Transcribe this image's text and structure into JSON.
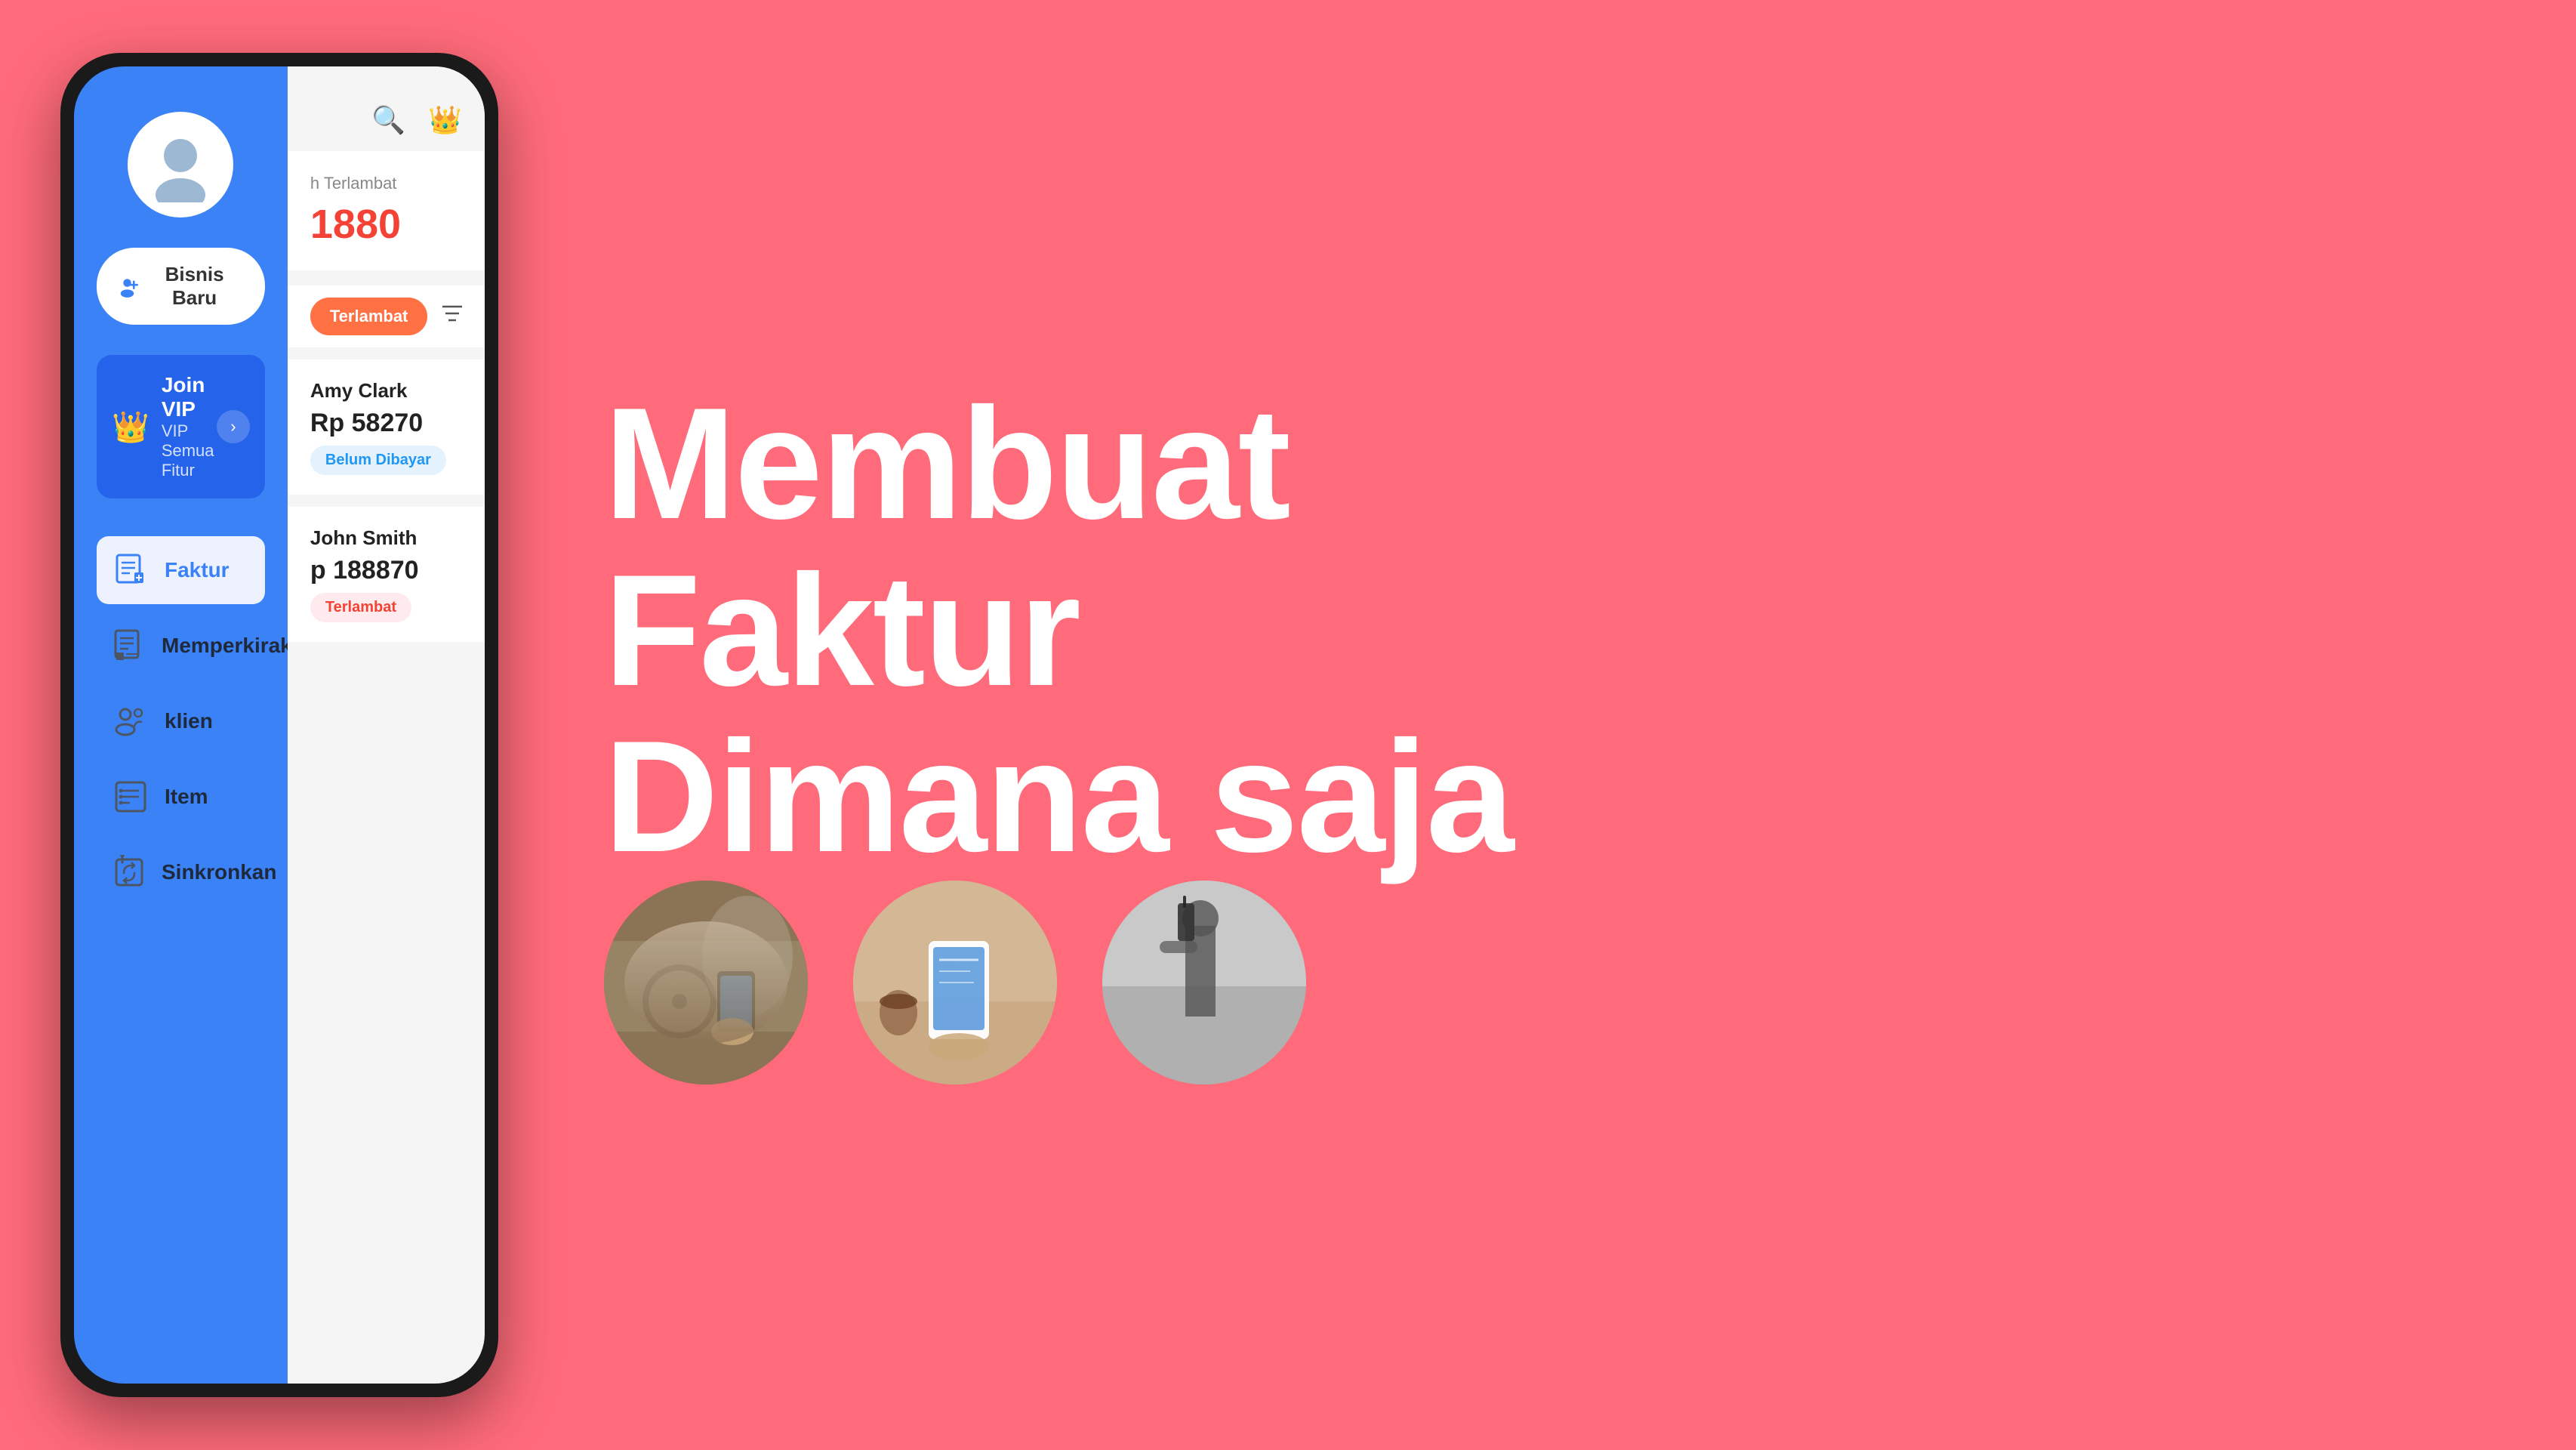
{
  "background_color": "#FF6B7A",
  "phone": {
    "sidebar": {
      "avatar_alt": "user avatar",
      "bisnis_btn_label": "Bisnis Baru",
      "bisnis_btn_icon": "👤+",
      "vip_card": {
        "title": "Join VIP",
        "subtitle": "VIP Semua Fitur",
        "crown_icon": "👑"
      },
      "nav_items": [
        {
          "label": "Faktur",
          "icon": "faktur-icon",
          "active": true
        },
        {
          "label": "Memperkirakan",
          "icon": "estimate-icon",
          "active": false
        },
        {
          "label": "klien",
          "icon": "client-icon",
          "active": false
        },
        {
          "label": "Item",
          "icon": "item-icon",
          "active": false
        },
        {
          "label": "Sinkronkan",
          "icon": "sync-icon",
          "active": false
        }
      ]
    },
    "main_panel": {
      "header": {
        "search_icon": "🔍",
        "crown_icon": "👑"
      },
      "stats": {
        "label": "h Terlambat",
        "value": "1880"
      },
      "filter": {
        "btn_label": "Terlambat",
        "filter_icon": "filter"
      },
      "invoices": [
        {
          "client": "Amy Clark",
          "amount": "Rp 58270",
          "status": "Belum Dibayar",
          "status_type": "unpaid"
        },
        {
          "client": "John Smith",
          "amount": "p 188870",
          "status": "Terlambat",
          "status_type": "late"
        }
      ]
    }
  },
  "headline": {
    "line1": "Membuat",
    "line2": "Faktur",
    "line3": "Dimana saja"
  },
  "photos": [
    {
      "alt": "person using phone in car",
      "type": "car"
    },
    {
      "alt": "person using phone on table",
      "type": "phone-hand"
    },
    {
      "alt": "person holding device outdoors",
      "type": "dark"
    }
  ]
}
